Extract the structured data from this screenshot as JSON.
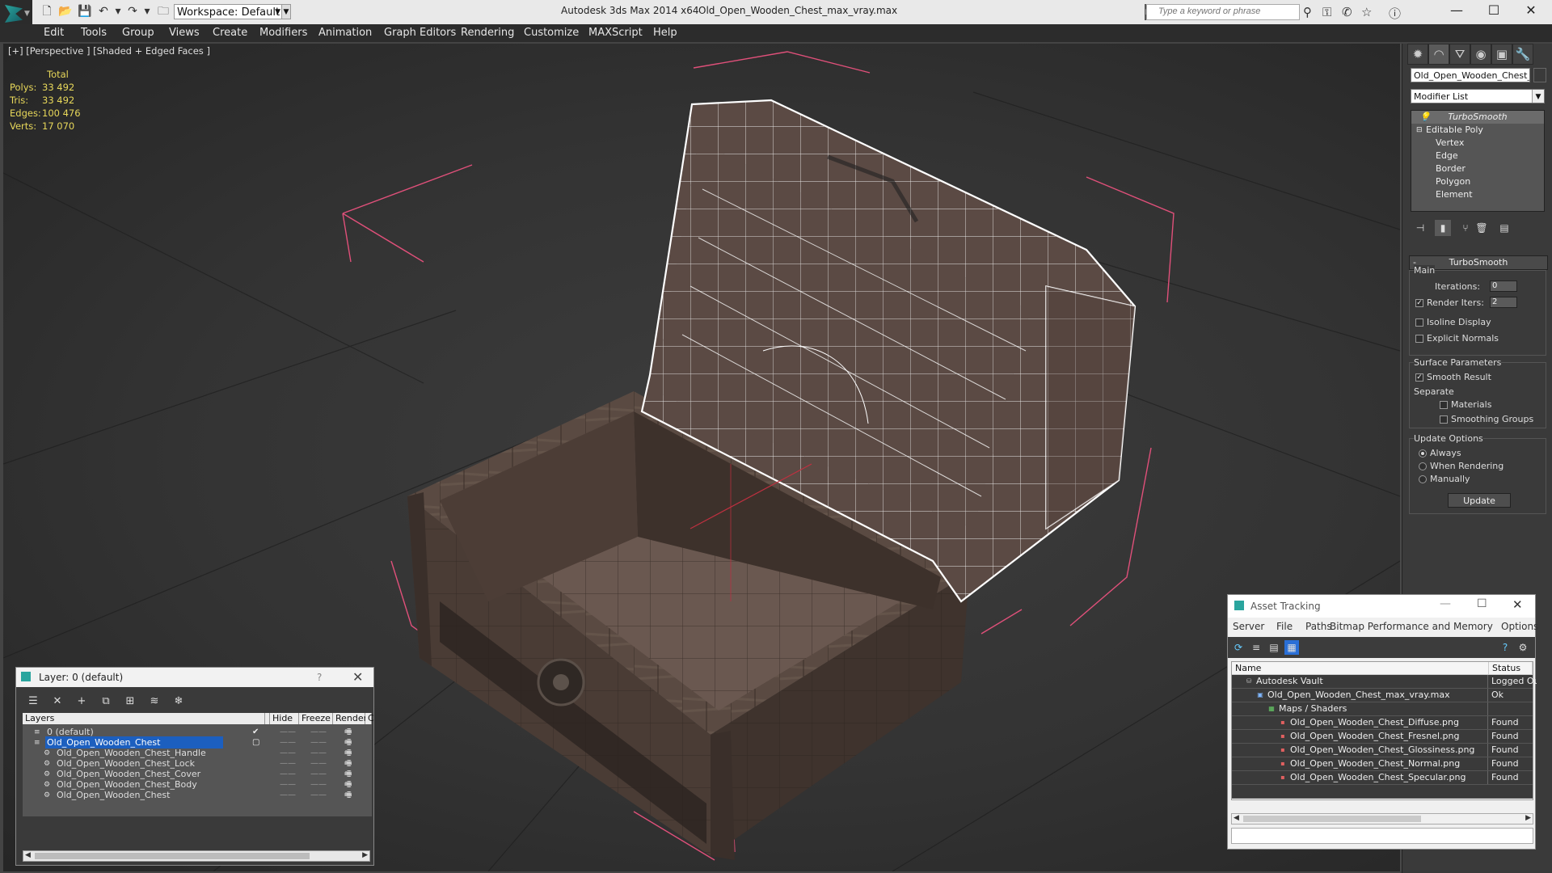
{
  "titlebar": {
    "workspace_label": "Workspace: Default",
    "app_title": "Autodesk 3ds Max  2014 x64",
    "file_title": "Old_Open_Wooden_Chest_max_vray.max",
    "search_placeholder": "Type a keyword or phrase"
  },
  "menu": [
    "Edit",
    "Tools",
    "Group",
    "Views",
    "Create",
    "Modifiers",
    "Animation",
    "Graph Editors",
    "Rendering",
    "Customize",
    "MAXScript",
    "Help"
  ],
  "viewport": {
    "label": "[+] [Perspective ] [Shaded + Edged Faces ]",
    "stats": {
      "total": "Total",
      "rows": [
        {
          "label": "Polys:",
          "value": "33 492"
        },
        {
          "label": "Tris:",
          "value": "33 492"
        },
        {
          "label": "Edges:",
          "value": "100 476"
        },
        {
          "label": "Verts:",
          "value": "17 070"
        }
      ]
    }
  },
  "command_panel": {
    "object_name": "Old_Open_Wooden_Chest_C",
    "modifier_list": "Modifier List",
    "stack": [
      "TurboSmooth",
      "Editable Poly",
      "Vertex",
      "Edge",
      "Border",
      "Polygon",
      "Element"
    ],
    "rollout_title": "TurboSmooth",
    "main_label": "Main",
    "iterations_label": "Iterations:",
    "iterations_value": "0",
    "render_iters_label": "Render Iters:",
    "render_iters_value": "2",
    "isoline_label": "Isoline Display",
    "explicit_normals_label": "Explicit Normals",
    "surface_params_label": "Surface Parameters",
    "smooth_result_label": "Smooth Result",
    "separate_label": "Separate",
    "materials_label": "Materials",
    "smoothing_groups_label": "Smoothing Groups",
    "update_options_label": "Update Options",
    "always_label": "Always",
    "when_rendering_label": "When Rendering",
    "manually_label": "Manually",
    "update_button": "Update"
  },
  "layer_panel": {
    "title": "Layer: 0 (default)",
    "help": "?",
    "columns": [
      "Layers",
      "Hide",
      "Freeze",
      "Render",
      "C"
    ],
    "rows": [
      {
        "name": "0 (default)",
        "indent": 0,
        "selected": false
      },
      {
        "name": "Old_Open_Wooden_Chest",
        "indent": 1,
        "selected": true
      },
      {
        "name": "Old_Open_Wooden_Chest_Handle",
        "indent": 2,
        "selected": false
      },
      {
        "name": "Old_Open_Wooden_Chest_Lock",
        "indent": 2,
        "selected": false
      },
      {
        "name": "Old_Open_Wooden_Chest_Cover",
        "indent": 2,
        "selected": false
      },
      {
        "name": "Old_Open_Wooden_Chest_Body",
        "indent": 2,
        "selected": false
      },
      {
        "name": "Old_Open_Wooden_Chest",
        "indent": 2,
        "selected": false
      }
    ]
  },
  "asset_panel": {
    "title": "Asset Tracking",
    "menu": [
      "Server",
      "File",
      "Paths",
      "Bitmap Performance and Memory",
      "Options"
    ],
    "columns": [
      "Name",
      "Status"
    ],
    "rows": [
      {
        "name": "Autodesk Vault",
        "status": "Logged Ou",
        "level": 0
      },
      {
        "name": "Old_Open_Wooden_Chest_max_vray.max",
        "status": "Ok",
        "level": 1
      },
      {
        "name": "Maps / Shaders",
        "status": "",
        "level": 2
      },
      {
        "name": "Old_Open_Wooden_Chest_Diffuse.png",
        "status": "Found",
        "level": 3
      },
      {
        "name": "Old_Open_Wooden_Chest_Fresnel.png",
        "status": "Found",
        "level": 3
      },
      {
        "name": "Old_Open_Wooden_Chest_Glossiness.png",
        "status": "Found",
        "level": 3
      },
      {
        "name": "Old_Open_Wooden_Chest_Normal.png",
        "status": "Found",
        "level": 3
      },
      {
        "name": "Old_Open_Wooden_Chest_Specular.png",
        "status": "Found",
        "level": 3
      }
    ]
  },
  "colors": {
    "accent_teal": "#2aa59e",
    "selection_blue": "#1c5fbf",
    "stats_yellow": "#e8d85a",
    "gizmo_pink": "#e0507a"
  }
}
